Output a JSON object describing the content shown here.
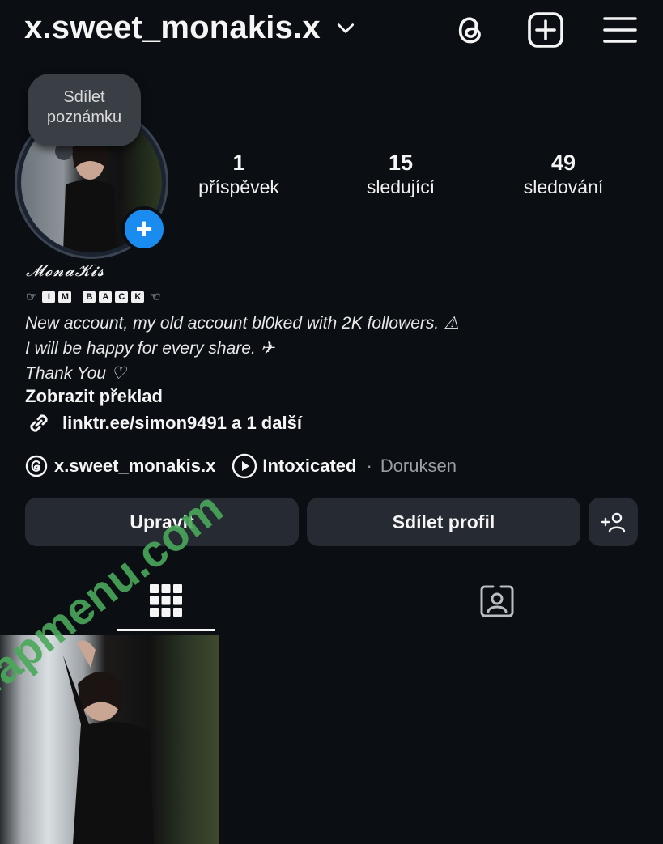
{
  "header": {
    "username": "x.sweet_monakis.x",
    "icons": [
      "chevron-down-icon",
      "threads-icon",
      "create-post-icon",
      "menu-icon"
    ]
  },
  "note": {
    "text_line1": "Sdílet",
    "text_line2": "poznámku"
  },
  "stats": [
    {
      "num": "1",
      "label": "příspěvek"
    },
    {
      "num": "15",
      "label": "sledující"
    },
    {
      "num": "49",
      "label": "sledování"
    }
  ],
  "bio": {
    "name": "𝓜𝓸𝓷𝓪𝓚𝓲𝓼",
    "imback_left": "☞",
    "imback_letters": [
      "I",
      "M",
      "B",
      "A",
      "C",
      "K"
    ],
    "imback_right": "☜",
    "lines": [
      "New account, my old account bl0ked with 2K followers. ⚠",
      "I will be happy for every share. ✈",
      "Thank You ♡"
    ],
    "translate": "Zobrazit překlad",
    "link": "linktr.ee/simon9491 a 1 další"
  },
  "meta": {
    "threads_handle": "x.sweet_monakis.x",
    "song": "Intoxicated",
    "separator": "·",
    "artist": "Doruksen"
  },
  "buttons": {
    "edit": "Upravit",
    "share": "Sdílet profil"
  },
  "watermark": "fapmenu.com",
  "colors": {
    "background": "#0b0f14",
    "button": "#262b33",
    "accent_blue": "#1a8cf0",
    "watermark": "#4aa85a"
  }
}
